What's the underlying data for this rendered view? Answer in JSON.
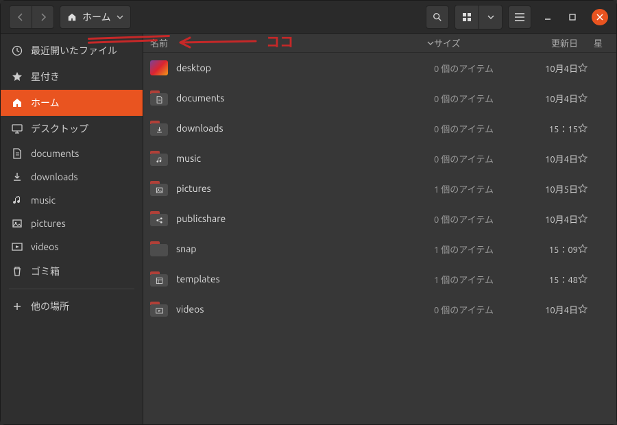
{
  "path": {
    "label": "ホーム"
  },
  "annotation": {
    "text": "ココ"
  },
  "sidebar": {
    "items": [
      {
        "label": "最近開いたファイル",
        "icon": "clock"
      },
      {
        "label": "星付き",
        "icon": "star"
      },
      {
        "label": "ホーム",
        "icon": "home",
        "active": true
      },
      {
        "label": "デスクトップ",
        "icon": "desktop"
      },
      {
        "label": "documents",
        "icon": "doc"
      },
      {
        "label": "downloads",
        "icon": "download"
      },
      {
        "label": "music",
        "icon": "music"
      },
      {
        "label": "pictures",
        "icon": "picture"
      },
      {
        "label": "videos",
        "icon": "video"
      },
      {
        "label": "ゴミ箱",
        "icon": "trash"
      },
      {
        "label": "他の場所",
        "icon": "plus",
        "sep": true
      }
    ]
  },
  "columns": {
    "name": "名前",
    "size": "サイズ",
    "modified": "更新日",
    "star": "星"
  },
  "folder_colors": {
    "tab": "#b04038",
    "body": "#4d4d4d"
  },
  "files": [
    {
      "name": "desktop",
      "icon": "desktop-grad",
      "size": "0 個のアイテム",
      "modified": "10月4日"
    },
    {
      "name": "documents",
      "icon": "doc",
      "size": "0 個のアイテム",
      "modified": "10月4日"
    },
    {
      "name": "downloads",
      "icon": "download",
      "size": "0 個のアイテム",
      "modified": "15：15"
    },
    {
      "name": "music",
      "icon": "music",
      "size": "0 個のアイテム",
      "modified": "10月4日"
    },
    {
      "name": "pictures",
      "icon": "picture",
      "size": "1 個のアイテム",
      "modified": "10月5日"
    },
    {
      "name": "publicshare",
      "icon": "share",
      "size": "0 個のアイテム",
      "modified": "10月4日"
    },
    {
      "name": "snap",
      "icon": "plain",
      "size": "1 個のアイテム",
      "modified": "15：09"
    },
    {
      "name": "templates",
      "icon": "template",
      "size": "1 個のアイテム",
      "modified": "15：48"
    },
    {
      "name": "videos",
      "icon": "video",
      "size": "0 個のアイテム",
      "modified": "10月4日"
    }
  ]
}
